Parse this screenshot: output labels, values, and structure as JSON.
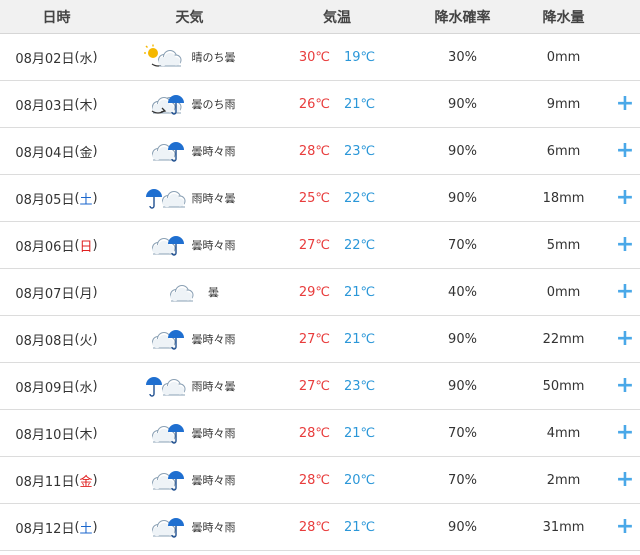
{
  "header": {
    "date": "日時",
    "weather": "天気",
    "temp": "気温",
    "precip_prob": "降水確率",
    "precip_amount": "降水量"
  },
  "rows": [
    {
      "date": "08月02日",
      "dow": "水",
      "dow_type": "weekday",
      "icon": "sunny-then-cloudy-icon",
      "weather": "晴のち曇",
      "high": "30℃",
      "low": "19℃",
      "prob": "30%",
      "amount": "0mm",
      "plus": ""
    },
    {
      "date": "08月03日",
      "dow": "木",
      "dow_type": "weekday",
      "icon": "cloudy-then-rain-icon",
      "weather": "曇のち雨",
      "high": "26℃",
      "low": "21℃",
      "prob": "90%",
      "amount": "9mm",
      "plus": "+"
    },
    {
      "date": "08月04日",
      "dow": "金",
      "dow_type": "weekday",
      "icon": "cloudy-sometimes-rain-icon",
      "weather": "曇時々雨",
      "high": "28℃",
      "low": "23℃",
      "prob": "90%",
      "amount": "6mm",
      "plus": "+"
    },
    {
      "date": "08月05日",
      "dow": "土",
      "dow_type": "sat",
      "icon": "rain-sometimes-cloudy-icon",
      "weather": "雨時々曇",
      "high": "25℃",
      "low": "22℃",
      "prob": "90%",
      "amount": "18mm",
      "plus": "+"
    },
    {
      "date": "08月06日",
      "dow": "日",
      "dow_type": "sun",
      "icon": "cloudy-sometimes-rain-icon",
      "weather": "曇時々雨",
      "high": "27℃",
      "low": "22℃",
      "prob": "70%",
      "amount": "5mm",
      "plus": "+"
    },
    {
      "date": "08月07日",
      "dow": "月",
      "dow_type": "weekday",
      "icon": "cloudy-icon",
      "weather": "曇",
      "high": "29℃",
      "low": "21℃",
      "prob": "40%",
      "amount": "0mm",
      "plus": "+"
    },
    {
      "date": "08月08日",
      "dow": "火",
      "dow_type": "weekday",
      "icon": "cloudy-sometimes-rain-icon",
      "weather": "曇時々雨",
      "high": "27℃",
      "low": "21℃",
      "prob": "90%",
      "amount": "22mm",
      "plus": "+"
    },
    {
      "date": "08月09日",
      "dow": "水",
      "dow_type": "weekday",
      "icon": "rain-sometimes-cloudy-icon",
      "weather": "雨時々曇",
      "high": "27℃",
      "low": "23℃",
      "prob": "90%",
      "amount": "50mm",
      "plus": "+"
    },
    {
      "date": "08月10日",
      "dow": "木",
      "dow_type": "weekday",
      "icon": "cloudy-sometimes-rain-icon",
      "weather": "曇時々雨",
      "high": "28℃",
      "low": "21℃",
      "prob": "70%",
      "amount": "4mm",
      "plus": "+"
    },
    {
      "date": "08月11日",
      "dow": "金",
      "dow_type": "hol",
      "icon": "cloudy-sometimes-rain-icon",
      "weather": "曇時々雨",
      "high": "28℃",
      "low": "20℃",
      "prob": "70%",
      "amount": "2mm",
      "plus": "+"
    },
    {
      "date": "08月12日",
      "dow": "土",
      "dow_type": "sat",
      "icon": "cloudy-sometimes-rain-icon",
      "weather": "曇時々雨",
      "high": "28℃",
      "low": "21℃",
      "prob": "90%",
      "amount": "31mm",
      "plus": "+"
    }
  ]
}
